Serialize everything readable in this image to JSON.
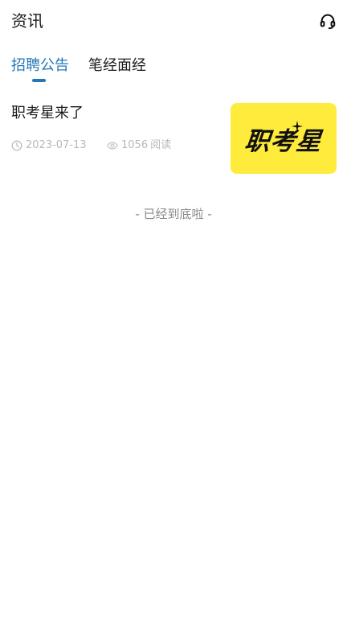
{
  "header": {
    "title": "资讯",
    "support_icon": "headset-icon"
  },
  "tabs": [
    {
      "label": "招聘公告",
      "active": true
    },
    {
      "label": "笔经面经",
      "active": false
    }
  ],
  "colors": {
    "accent": "#2477b8",
    "thumb_bg": "#ffeb3b"
  },
  "articles": [
    {
      "title": "职考星来了",
      "date": "2023-07-13",
      "views": "1056",
      "views_suffix": "阅读",
      "thumbnail_text": "职考星"
    }
  ],
  "list_end_text": "- 已经到底啦 -"
}
